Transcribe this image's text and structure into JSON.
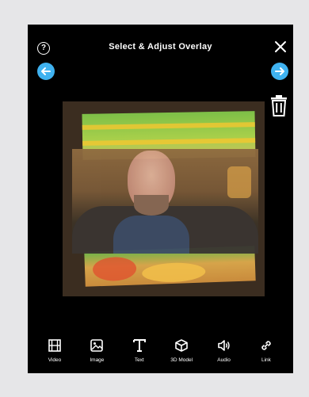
{
  "header": {
    "title": "Select & Adjust Overlay",
    "help_glyph": "?"
  },
  "icons": {
    "help": "help-icon",
    "close": "close-icon",
    "back": "arrow-left-icon",
    "forward": "arrow-right-icon",
    "trash": "trash-icon"
  },
  "colors": {
    "accent": "#3fb2f0",
    "background": "#000000",
    "frame": "#e6e6e8"
  },
  "toolbar": {
    "items": [
      {
        "label": "Video",
        "icon": "film-icon"
      },
      {
        "label": "Image",
        "icon": "image-icon"
      },
      {
        "label": "Text",
        "icon": "text-icon"
      },
      {
        "label": "3D Model",
        "icon": "cube-icon"
      },
      {
        "label": "Audio",
        "icon": "speaker-icon"
      },
      {
        "label": "Link",
        "icon": "link-icon"
      }
    ]
  }
}
